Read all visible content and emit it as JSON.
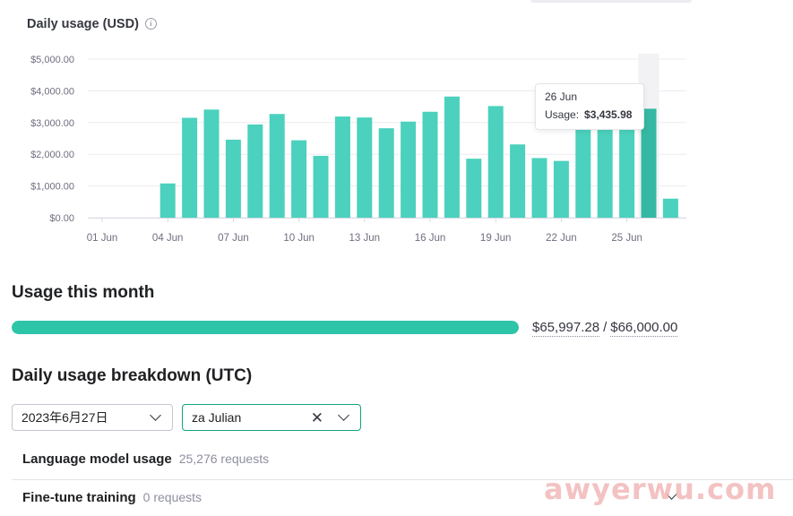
{
  "chart_data": {
    "type": "bar",
    "title": "Daily usage (USD)",
    "categories": [
      "01 Jun",
      "02 Jun",
      "03 Jun",
      "04 Jun",
      "05 Jun",
      "06 Jun",
      "07 Jun",
      "08 Jun",
      "09 Jun",
      "10 Jun",
      "11 Jun",
      "12 Jun",
      "13 Jun",
      "14 Jun",
      "15 Jun",
      "16 Jun",
      "17 Jun",
      "18 Jun",
      "19 Jun",
      "20 Jun",
      "21 Jun",
      "22 Jun",
      "23 Jun",
      "24 Jun",
      "25 Jun",
      "26 Jun",
      "27 Jun"
    ],
    "values": [
      0,
      0,
      0,
      1080,
      3150,
      3410,
      2460,
      2940,
      3270,
      2440,
      1950,
      3190,
      3160,
      2820,
      3030,
      3340,
      3820,
      1860,
      3520,
      2310,
      1880,
      1790,
      2800,
      4100,
      2800,
      3435.98,
      600
    ],
    "x_tick_labels": [
      "01 Jun",
      "04 Jun",
      "07 Jun",
      "10 Jun",
      "13 Jun",
      "16 Jun",
      "19 Jun",
      "22 Jun",
      "25 Jun"
    ],
    "y_tick_labels": [
      "$0.00",
      "$1,000.00",
      "$2,000.00",
      "$3,000.00",
      "$4,000.00",
      "$5,000.00"
    ],
    "ylim": [
      0,
      5000
    ],
    "grid": true,
    "bar_color": "#4bd1bd",
    "highlight_color": "#35b8a3",
    "highlight_index": 25
  },
  "tooltip": {
    "date": "26 Jun",
    "label": "Usage:",
    "value": "$3,435.98"
  },
  "usage_this_month": {
    "title": "Usage this month",
    "used": "$65,997.28",
    "separator": "/",
    "limit": "$66,000.00",
    "progress_fraction": 0.99996
  },
  "breakdown": {
    "title": "Daily usage breakdown (UTC)",
    "date_select": "2023年6月27日",
    "user_select": "za Julian",
    "rows": [
      {
        "name": "Language model usage",
        "count": "25,276 requests"
      },
      {
        "name": "Fine-tune training",
        "count": "0 requests"
      }
    ]
  },
  "watermark": "awyerwu.com",
  "colors": {
    "accent": "#2cc5a8",
    "select_active_border": "#10a37f"
  }
}
